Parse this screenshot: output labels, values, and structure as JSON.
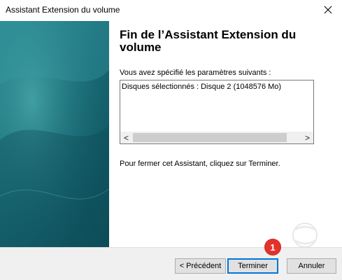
{
  "window": {
    "title": "Assistant Extension du volume",
    "close_icon": "close-icon"
  },
  "content": {
    "heading": "Fin de l’Assistant Extension du volume",
    "params_label": "Vous avez spécifié les paramètres suivants :",
    "listbox_lines": [
      "Disques sélectionnés : Disque 2 (1048576 Mo)"
    ],
    "closing_text": "Pour fermer cet Assistant, cliquez sur Terminer."
  },
  "scrollbar": {
    "left_arrow": "<",
    "right_arrow": ">"
  },
  "buttons": {
    "previous": "< Précédent",
    "finish": "Terminer",
    "cancel": "Annuler"
  },
  "annotation": {
    "marker_number": "1",
    "marker_color": "#e4322b"
  },
  "colors": {
    "side_panel": "#1a6e79",
    "default_button_border": "#0078d7"
  }
}
